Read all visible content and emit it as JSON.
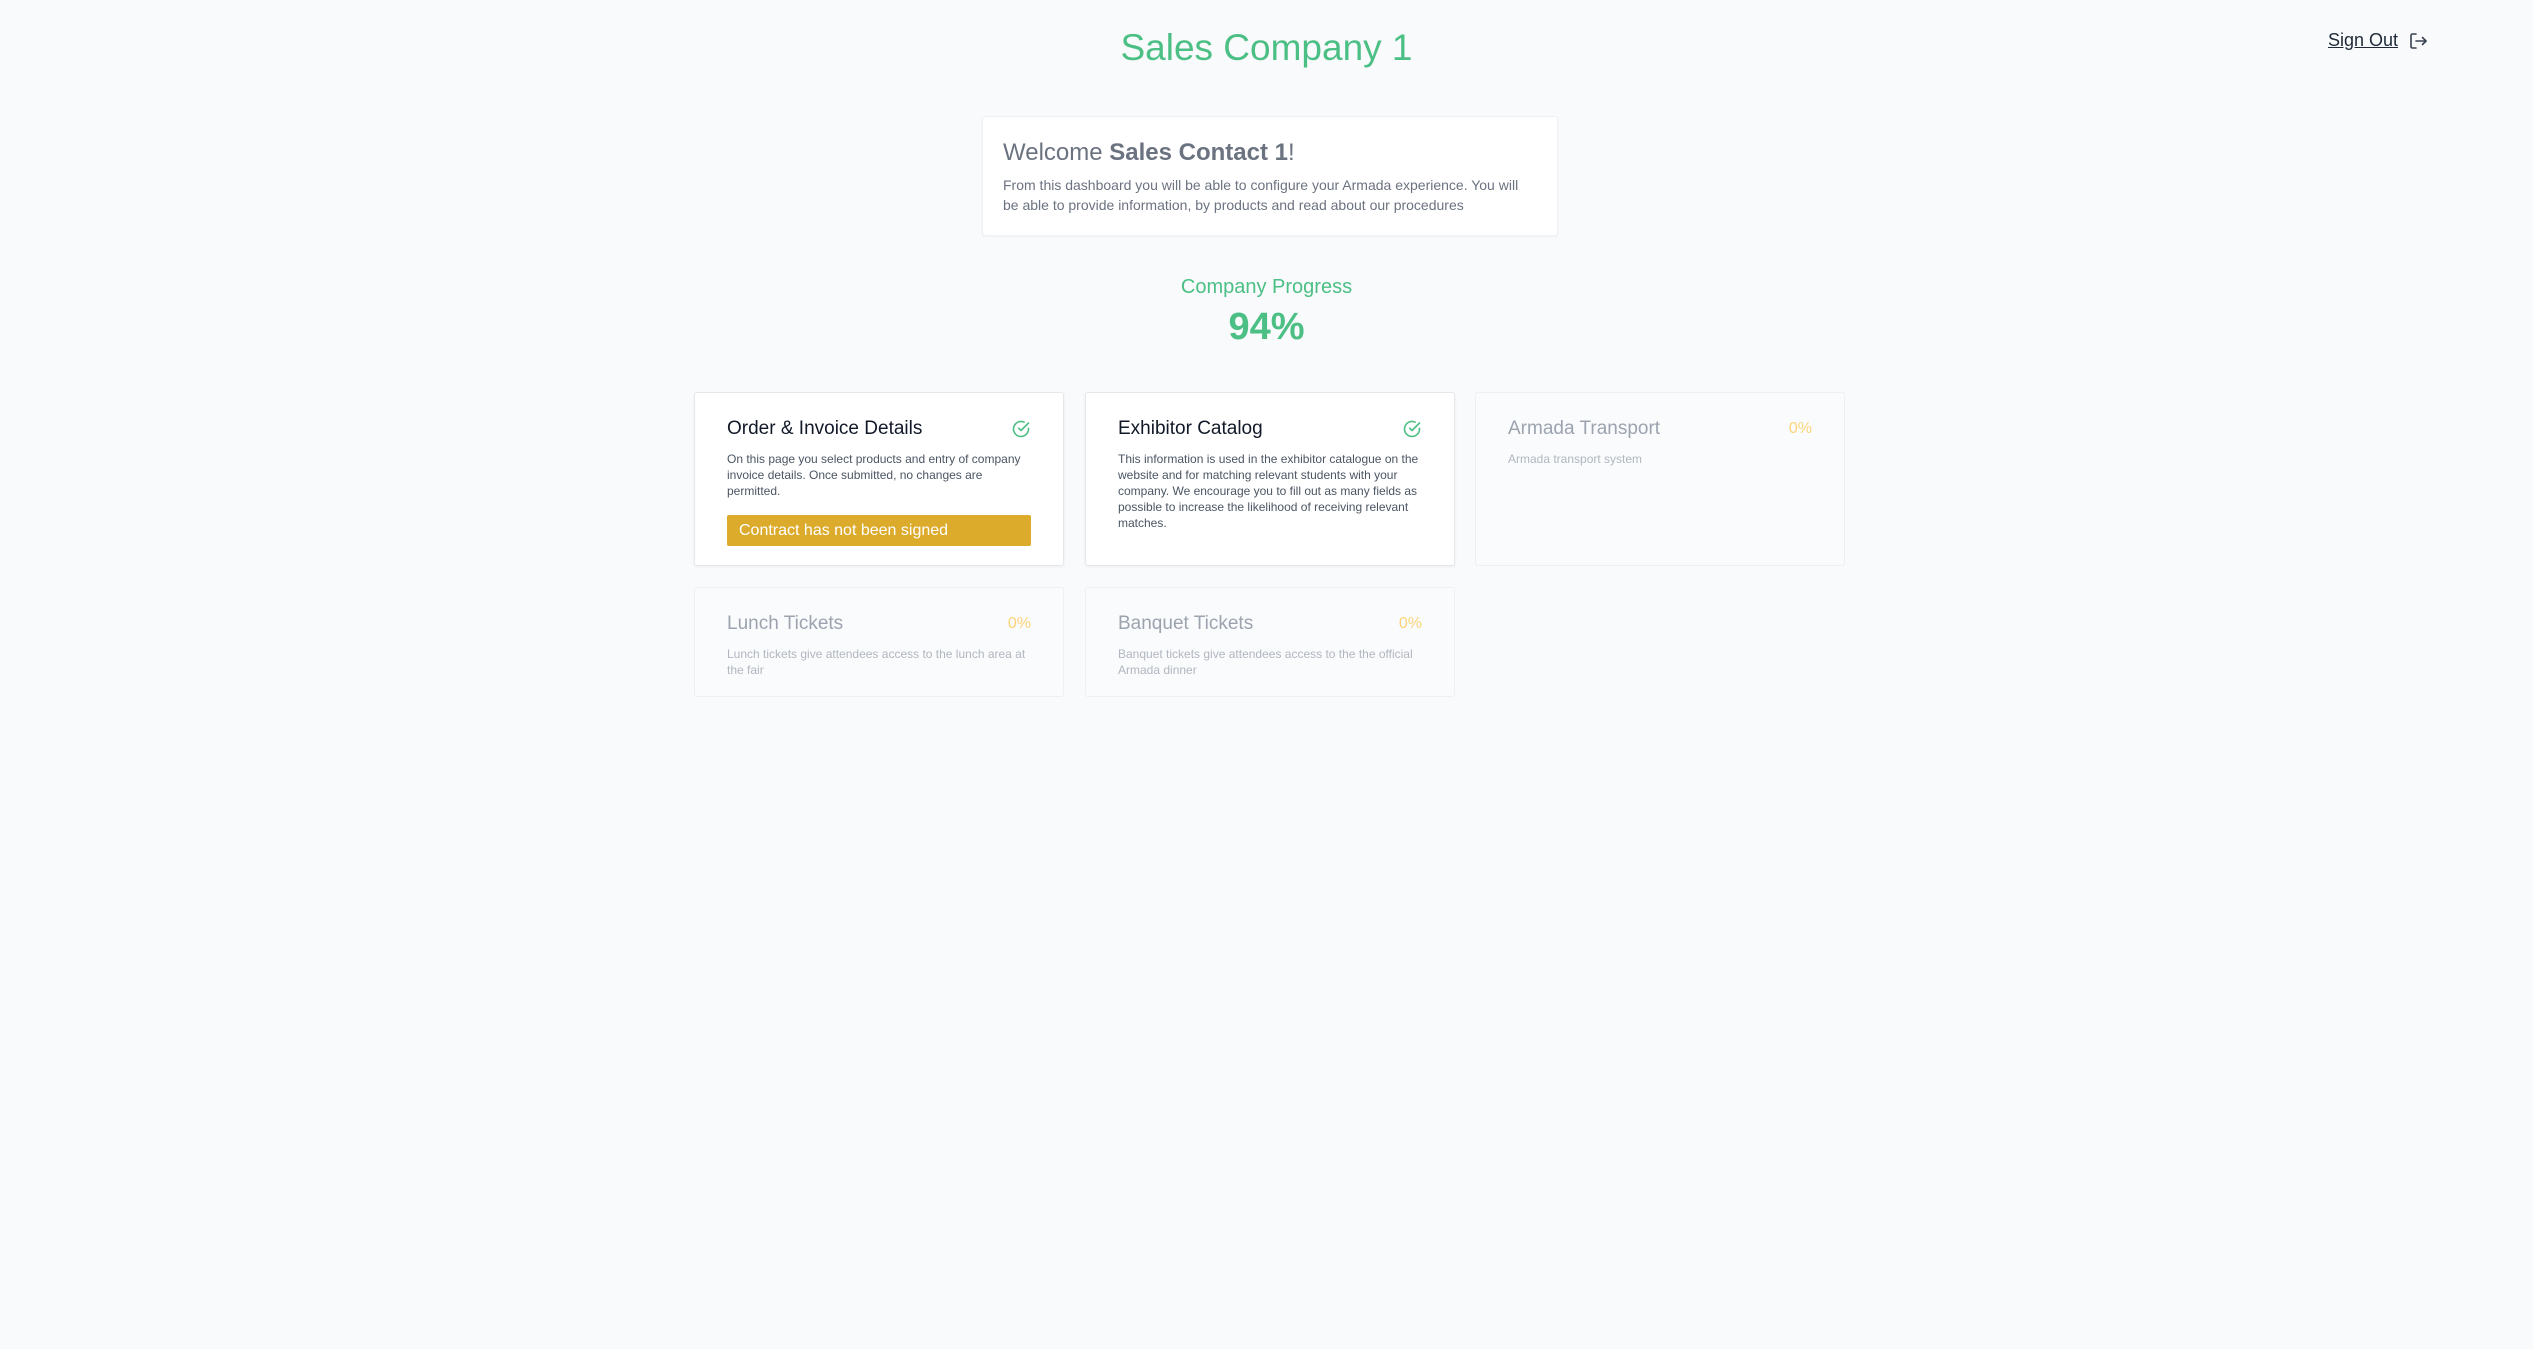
{
  "header": {
    "company_name": "Sales Company 1",
    "signout_label": "Sign Out"
  },
  "welcome": {
    "greeting": "Welcome",
    "contact_name": "Sales Contact 1",
    "exclamation": "!",
    "description": "From this dashboard you will be able to configure your Armada experience. You will be able to provide information, by products and read about our procedures"
  },
  "progress": {
    "label": "Company Progress",
    "value": "94%"
  },
  "cards": [
    {
      "title": "Order & Invoice Details",
      "status": "complete",
      "status_icon": "check-circle-icon",
      "description": "On this page you select products and entry of company invoice details. Once submitted, no changes are permitted.",
      "warning": "Contract has not been signed"
    },
    {
      "title": "Exhibitor Catalog",
      "status": "complete",
      "status_icon": "check-circle-icon",
      "description": "This information is used in the exhibitor catalogue on the website and for matching relevant students with your company. We encourage you to fill out as many fields as possible to increase the likelihood of receiving relevant matches."
    },
    {
      "title": "Armada Transport",
      "progress": "0%",
      "description": "Armada transport system"
    },
    {
      "title": "Lunch Tickets",
      "progress": "0%",
      "description": "Lunch tickets give attendees access to the lunch area at the fair"
    },
    {
      "title": "Banquet Tickets",
      "progress": "0%",
      "description": "Banquet tickets give attendees access to the the official Armada dinner"
    }
  ],
  "colors": {
    "accent": "#4cbf85",
    "warning": "#dcab2c",
    "pending": "#fcd37a",
    "background": "#f8fafc"
  }
}
